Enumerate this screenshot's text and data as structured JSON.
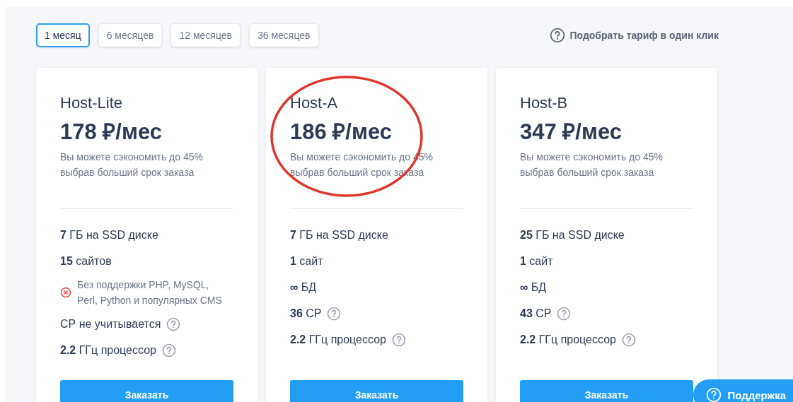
{
  "periods": [
    {
      "label": "1 месяц",
      "selected": true
    },
    {
      "label": "6 месяцев",
      "selected": false
    },
    {
      "label": "12 месяцев",
      "selected": false
    },
    {
      "label": "36 месяцев",
      "selected": false
    }
  ],
  "tariff_picker": {
    "label": "Подобрать тариф в один клик"
  },
  "plans": [
    {
      "name": "Host-Lite",
      "price": "178 ₽/мес",
      "note": "Вы можете сэкономить до 45% выбрав больший срок заказа",
      "features": [
        {
          "kind": "plain",
          "text": "**7** ГБ на SSD диске"
        },
        {
          "kind": "plain",
          "text": "**15** сайтов"
        },
        {
          "kind": "unsupported",
          "text": "Без поддержки PHP, MySQL, Perl, Python и популярных CMS"
        },
        {
          "kind": "help",
          "text": "СР не учитывается"
        },
        {
          "kind": "help",
          "text": "**2.2** ГГц процессор"
        }
      ],
      "button": "Заказать"
    },
    {
      "name": "Host-A",
      "price": "186 ₽/мес",
      "note": "Вы можете сэкономить до 45% выбрав больший срок заказа",
      "features": [
        {
          "kind": "plain",
          "text": "**7** ГБ на SSD диске"
        },
        {
          "kind": "plain",
          "text": "**1** сайт"
        },
        {
          "kind": "plain",
          "text": "**∞** БД"
        },
        {
          "kind": "help",
          "text": "**36** СР"
        },
        {
          "kind": "help",
          "text": "**2.2** ГГц процессор"
        }
      ],
      "button": "Заказать"
    },
    {
      "name": "Host-B",
      "price": "347 ₽/мес",
      "note": "Вы можете сэкономить до 45% выбрав больший срок заказа",
      "features": [
        {
          "kind": "plain",
          "text": "**25** ГБ на SSD диске"
        },
        {
          "kind": "plain",
          "text": "**1** сайт"
        },
        {
          "kind": "plain",
          "text": "**∞** БД"
        },
        {
          "kind": "help",
          "text": "**43** СР"
        },
        {
          "kind": "help",
          "text": "**2.2** ГГц процессор"
        }
      ],
      "button": "Заказать"
    }
  ],
  "support_button": {
    "label": "Поддержка"
  }
}
